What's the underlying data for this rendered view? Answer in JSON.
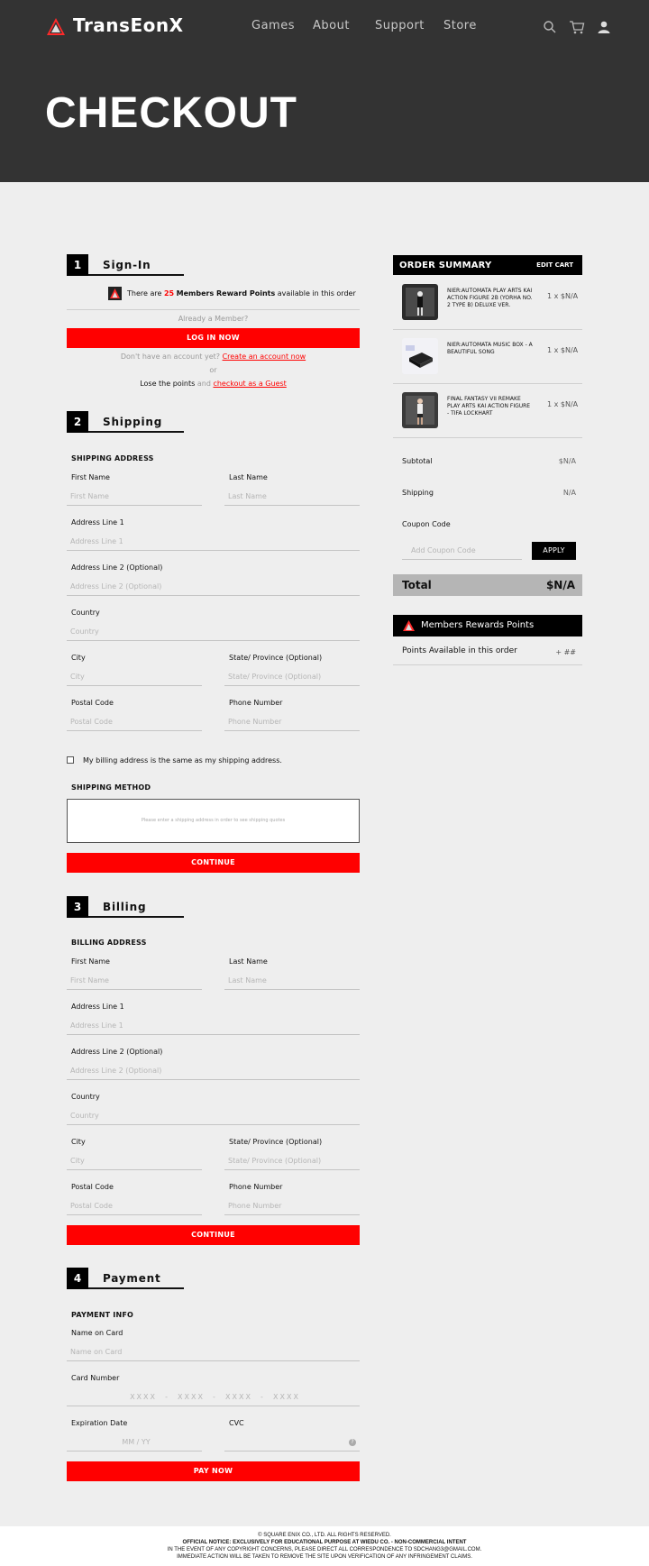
{
  "header": {
    "brand": "TransEonX",
    "nav": [
      "Games",
      "About",
      "Support",
      "Store"
    ],
    "icons": [
      "search-icon",
      "cart-icon",
      "user-icon"
    ],
    "hero_title": "CHECKOUT"
  },
  "signin": {
    "number": "1",
    "title": "Sign-In",
    "reward_prefix": "There are",
    "reward_points": "25",
    "reward_label": "Members Reward Points",
    "reward_suffix": "available in this order",
    "already_member": "Already a Member?",
    "login_button": "LOG IN NOW",
    "no_account": "Don't have an account yet?",
    "create_account": "Create an account now",
    "or": "or",
    "lose_points": "Lose the points",
    "and": "and",
    "guest": "checkout as a Guest"
  },
  "shipping": {
    "number": "2",
    "title": "Shipping",
    "address_heading": "SHIPPING ADDRESS",
    "first_name": {
      "label": "First Name",
      "placeholder": "First Name"
    },
    "last_name": {
      "label": "Last Name",
      "placeholder": "Last Name"
    },
    "address1": {
      "label": "Address Line 1",
      "placeholder": "Address Line 1"
    },
    "address2": {
      "label": "Address Line 2 (Optional)",
      "placeholder": "Address Line 2 (Optional)"
    },
    "country": {
      "label": "Country",
      "placeholder": "Country"
    },
    "city": {
      "label": "City",
      "placeholder": "City"
    },
    "state": {
      "label": "State/ Province (Optional)",
      "placeholder": "State/ Province (Optional)"
    },
    "postal": {
      "label": "Postal Code",
      "placeholder": "Postal Code"
    },
    "phone": {
      "label": "Phone Number",
      "placeholder": "Phone Number"
    },
    "billing_same": "My billing address is the same as my shipping address.",
    "method_heading": "SHIPPING METHOD",
    "method_note": "Please enter a shipping address in order to see shipping quotes",
    "continue": "CONTINUE"
  },
  "billing": {
    "number": "3",
    "title": "Billing",
    "address_heading": "BILLING ADDRESS",
    "first_name": {
      "label": "First Name",
      "placeholder": "First Name"
    },
    "last_name": {
      "label": "Last Name",
      "placeholder": "Last Name"
    },
    "address1": {
      "label": "Address Line 1",
      "placeholder": "Address Line 1"
    },
    "address2": {
      "label": "Address Line 2 (Optional)",
      "placeholder": "Address Line 2 (Optional)"
    },
    "country": {
      "label": "Country",
      "placeholder": "Country"
    },
    "city": {
      "label": "City",
      "placeholder": "City"
    },
    "state": {
      "label": "State/ Province (Optional)",
      "placeholder": "State/ Province (Optional)"
    },
    "postal": {
      "label": "Postal Code",
      "placeholder": "Postal Code"
    },
    "phone": {
      "label": "Phone Number",
      "placeholder": "Phone Number"
    },
    "continue": "CONTINUE"
  },
  "payment": {
    "number": "4",
    "title": "Payment",
    "info_heading": "PAYMENT INFO",
    "name_on_card": {
      "label": "Name on Card",
      "placeholder": "Name on Card"
    },
    "card_number": {
      "label": "Card Number",
      "placeholder": "XXXX  -  XXXX  -  XXXX  -  XXXX"
    },
    "expiration": {
      "label": "Expiration Date",
      "placeholder": "MM / YY"
    },
    "cvc": {
      "label": "CVC",
      "help": "?"
    },
    "pay_button": "PAY NOW"
  },
  "order_summary": {
    "title": "ORDER SUMMARY",
    "edit_cart": "EDIT CART",
    "items": [
      {
        "name": "NIER:AUTOMATA PLAY ARTS KAI ACTION FIGURE 2B (YORHA NO. 2 TYPE B) DELUXE VER.",
        "qty": "1  x  $N/A"
      },
      {
        "name": "NIER:AUTOMATA MUSIC BOX - A BEAUTIFUL SONG",
        "qty": "1  x  $N/A"
      },
      {
        "name": "FINAL FANTASY VII REMAKE PLAY ARTS KAI ACTION FIGURE - TIFA LOCKHART",
        "qty": "1  x  $N/A"
      }
    ],
    "subtotal_label": "Subtotal",
    "subtotal_value": "$N/A",
    "shipping_label": "Shipping",
    "shipping_value": "N/A",
    "coupon_label": "Coupon Code",
    "coupon_placeholder": "Add Coupon Code",
    "apply": "APPLY",
    "total_label": "Total",
    "total_value": "$N/A"
  },
  "rewards": {
    "title": "Members Rewards Points",
    "available_label": "Points Available in this order",
    "available_value": "+ ##"
  },
  "footer": {
    "line1": "© SQUARE ENIX CO., LTD. ALL RIGHTS RESERVED.",
    "line2": "OFFICIAL NOTICE: EXCLUSIVELY FOR EDUCATIONAL PURPOSE AT WIEDU CO. - NON-COMMERCIAL INTENT",
    "line3": "IN THE EVENT OF ANY COPYRIGHT CONCERNS, PLEASE DIRECT ALL CORRESPONDENCE TO SDCHANG3@GMAIL.COM.",
    "line4": "IMMEDIATE ACTION WILL BE TAKEN TO REMOVE THE SITE UPON VERIFICATION OF ANY INFRINGEMENT CLAIMS."
  },
  "colors": {
    "accent": "#ff0000",
    "header_bg": "#333333",
    "page_bg": "#eeeeee"
  }
}
